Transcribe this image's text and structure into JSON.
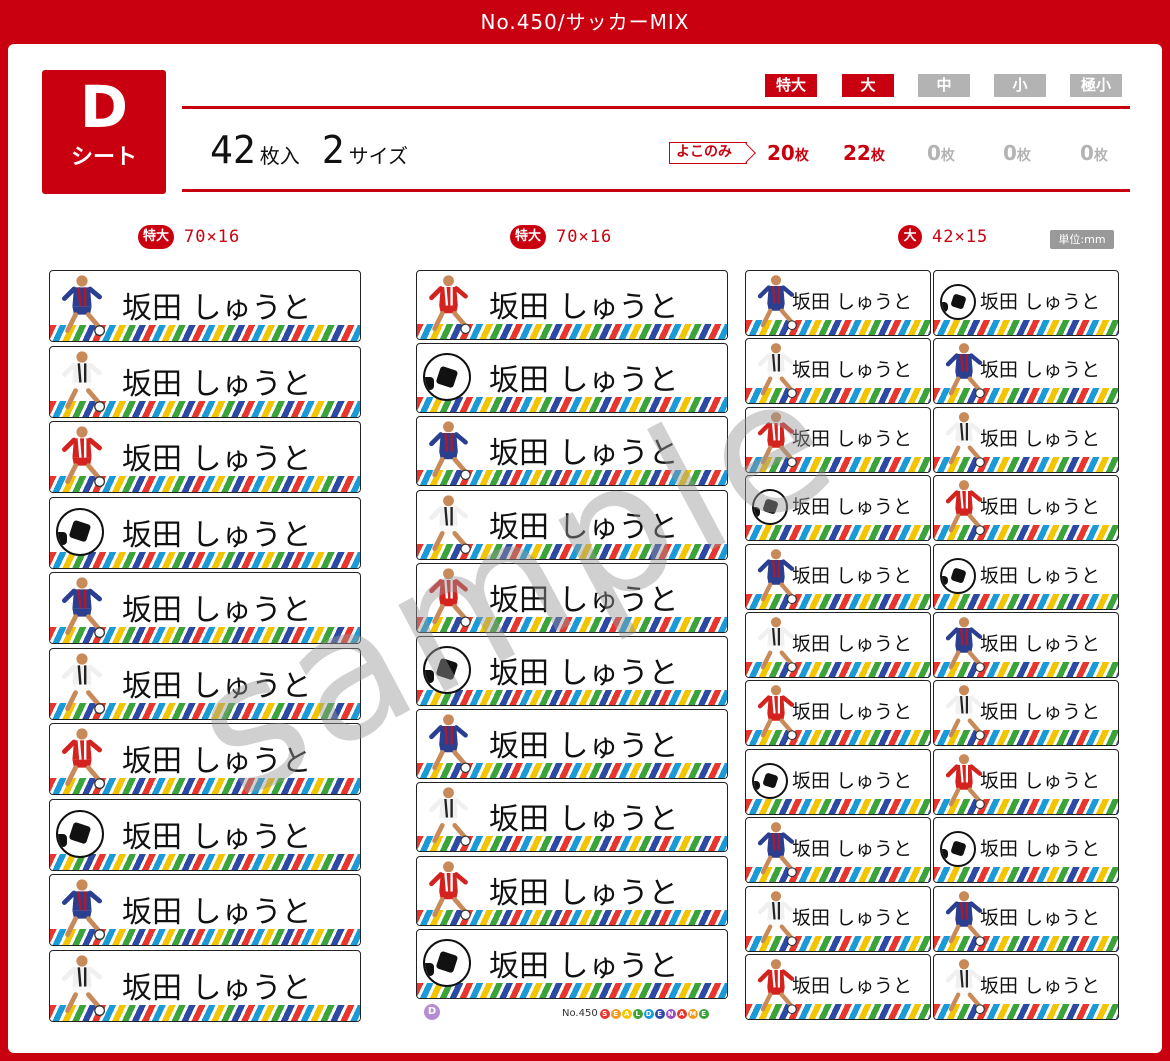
{
  "title": "No.450/サッカーMIX",
  "sheet": {
    "letter": "D",
    "label": "シート"
  },
  "summary": {
    "count": "42",
    "count_unit": "枚入",
    "sizes": "2",
    "sizes_unit": "サイズ"
  },
  "size_tags": [
    {
      "label": "特大",
      "active": true
    },
    {
      "label": "大",
      "active": true
    },
    {
      "label": "中",
      "active": false
    },
    {
      "label": "小",
      "active": false
    },
    {
      "label": "極小",
      "active": false
    }
  ],
  "orientation": "よこのみ",
  "counts": [
    {
      "num": "20",
      "unit": "枚"
    },
    {
      "num": "22",
      "unit": "枚"
    },
    {
      "num": "0",
      "unit": "枚"
    },
    {
      "num": "0",
      "unit": "枚"
    },
    {
      "num": "0",
      "unit": "枚"
    }
  ],
  "columns": [
    {
      "tag": "特大",
      "dims": "70×16"
    },
    {
      "tag": "特大",
      "dims": "70×16"
    },
    {
      "tag": "大",
      "dims": "42×15"
    }
  ],
  "unit_note": "単位:mm",
  "label_name": "坂田 しゅうと",
  "watermark": "sample",
  "footer": {
    "sheet_letter": "D",
    "product_no": "No.450",
    "brand": "SEALDENAME"
  },
  "colors": {
    "brand_red": "#c9000f",
    "inactive_gray": "#b3b3b3"
  },
  "icon_sequences": {
    "col1": [
      "player-blue",
      "player-stripes",
      "player-red",
      "ball",
      "player-blue",
      "player-stripes",
      "player-red",
      "ball",
      "player-blue",
      "player-stripes"
    ],
    "col2": [
      "player-red",
      "ball",
      "player-blue",
      "player-stripes",
      "player-red",
      "ball",
      "player-blue",
      "player-stripes",
      "player-red",
      "ball"
    ],
    "col3a": [
      "player-blue",
      "player-stripes",
      "player-red",
      "ball",
      "player-blue",
      "player-stripes",
      "player-red",
      "ball",
      "player-blue",
      "player-stripes",
      "player-red"
    ],
    "col3b": [
      "ball",
      "player-blue",
      "player-stripes",
      "player-red",
      "ball",
      "player-blue",
      "player-stripes",
      "player-red",
      "ball",
      "player-blue",
      "player-stripes"
    ]
  }
}
